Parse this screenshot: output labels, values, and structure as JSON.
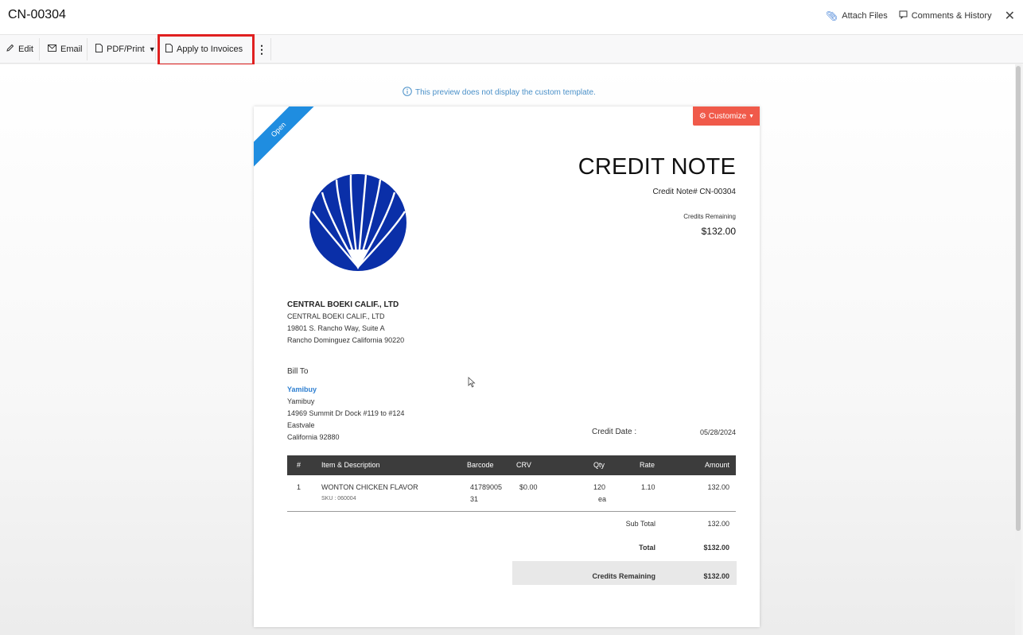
{
  "header": {
    "title": "CN-00304",
    "attach_files": "Attach Files",
    "comments_history": "Comments & History"
  },
  "toolbar": {
    "edit": "Edit",
    "email": "Email",
    "pdf_print": "PDF/Print",
    "apply_to_invoices": "Apply to Invoices"
  },
  "preview_note": "This preview does not display the custom template.",
  "document": {
    "status_ribbon": "Open",
    "customize_label": "Customize",
    "title": "CREDIT NOTE",
    "number_line": "Credit Note# CN-00304",
    "credits_remaining_label": "Credits Remaining",
    "credits_remaining_amount": "$132.00",
    "org": {
      "name": "CENTRAL BOEKI CALIF., LTD",
      "line1": "CENTRAL BOEKI CALIF., LTD",
      "line2": "19801 S. Rancho Way, Suite A",
      "line3": "Rancho Dominguez California 90220"
    },
    "bill_to": {
      "label": "Bill To",
      "customer_link": "Yamibuy",
      "line1": "Yamibuy",
      "line2": "14969 Summit Dr Dock #119 to #124",
      "line3": "Eastvale",
      "line4": "California 92880"
    },
    "credit_date_label": "Credit Date :",
    "credit_date_value": "05/28/2024",
    "columns": {
      "num": "#",
      "item": "Item & Description",
      "barcode": "Barcode",
      "crv": "CRV",
      "qty": "Qty",
      "rate": "Rate",
      "amount": "Amount"
    },
    "items": [
      {
        "num": "1",
        "name": "WONTON CHICKEN FLAVOR",
        "sku": "SKU : 060004",
        "barcode_line1": "41789005",
        "barcode_line2": "31",
        "crv": "$0.00",
        "qty": "120",
        "unit": "ea",
        "rate": "1.10",
        "amount": "132.00"
      }
    ],
    "totals": {
      "sub_total_label": "Sub Total",
      "sub_total_value": "132.00",
      "total_label": "Total",
      "total_value": "$132.00",
      "credits_remaining_label": "Credits Remaining",
      "credits_remaining_value": "$132.00"
    }
  },
  "colors": {
    "ribbon": "#1f8de0",
    "customize": "#f05a4a",
    "table_header": "#3c3c3c",
    "link": "#2e7fd1",
    "logo": "#0a2fa8",
    "highlight": "#e02020"
  }
}
